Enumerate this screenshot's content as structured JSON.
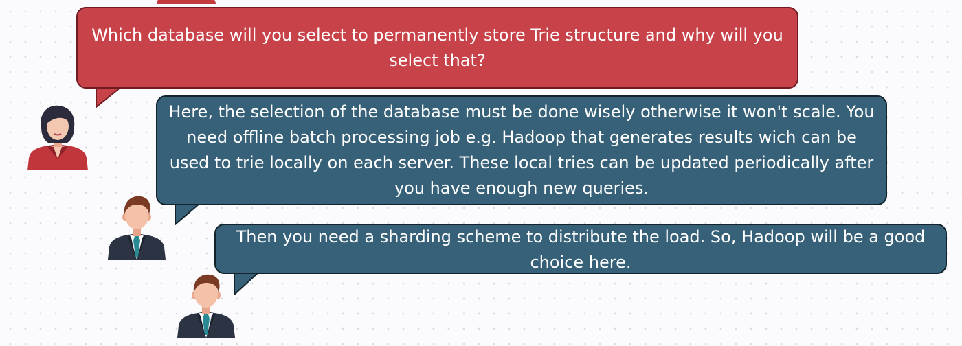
{
  "colors": {
    "question_bubble": "#c8424a",
    "answer_bubble": "#376178",
    "bubble_text": "#ffffff"
  },
  "conversation": [
    {
      "speaker": "woman-icon",
      "text": "Which database will you select to permanently store Trie structure and why will you select that?"
    },
    {
      "speaker": "man-icon",
      "text": "Here, the selection of the database must be done wisely otherwise it won't scale. You need offline batch processing job e.g. Hadoop that generates results wich can be used to trie locally on each server. These local tries can be updated periodically after you have enough new queries."
    },
    {
      "speaker": "man-icon",
      "text": "Then you need a sharding scheme to distribute the load. So, Hadoop will be a good choice here."
    }
  ]
}
